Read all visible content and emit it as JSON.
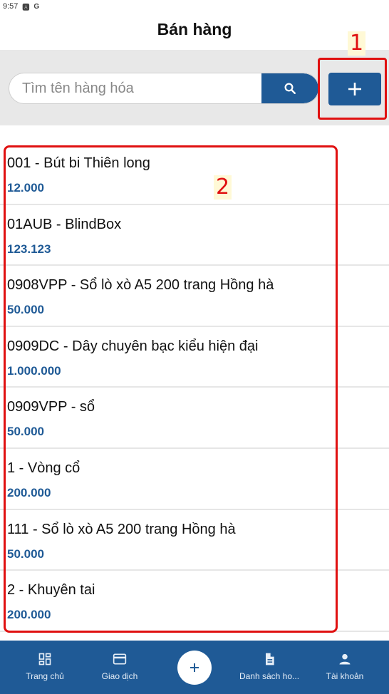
{
  "status_bar": {
    "time": "9:57",
    "icons": [
      "a-notification-icon",
      "google-icon"
    ]
  },
  "header": {
    "title": "Bán hàng"
  },
  "search": {
    "placeholder": "Tìm tên hàng hóa"
  },
  "annotations": {
    "one": "1",
    "two": "2",
    "color": "#e01010"
  },
  "products": [
    {
      "name": "001 - Bút bi Thiên long",
      "price": "12.000"
    },
    {
      "name": "01AUB - BlindBox",
      "price": "123.123"
    },
    {
      "name": "0908VPP - Sổ lò xò A5 200 trang Hồng hà",
      "price": "50.000"
    },
    {
      "name": "0909DC - Dây chuyên bạc kiểu hiện đại",
      "price": "1.000.000"
    },
    {
      "name": "0909VPP - sổ",
      "price": "50.000"
    },
    {
      "name": "1 - Vòng cổ",
      "price": "200.000"
    },
    {
      "name": "111 - Sổ lò xò A5 200 trang Hồng hà",
      "price": "50.000"
    },
    {
      "name": "2 - Khuyên tai",
      "price": "200.000"
    }
  ],
  "bottom_nav": {
    "items": [
      {
        "label": "Trang chủ",
        "icon": "dashboard-icon"
      },
      {
        "label": "Giao dịch",
        "icon": "credit-card-icon"
      },
      {
        "label": "Danh sách ho...",
        "icon": "document-icon"
      },
      {
        "label": "Tài khoản",
        "icon": "person-icon"
      }
    ],
    "center_icon": "plus-icon"
  },
  "colors": {
    "primary": "#1f5a96",
    "search_bg": "#e8e8e8",
    "price": "#1f5a96"
  }
}
